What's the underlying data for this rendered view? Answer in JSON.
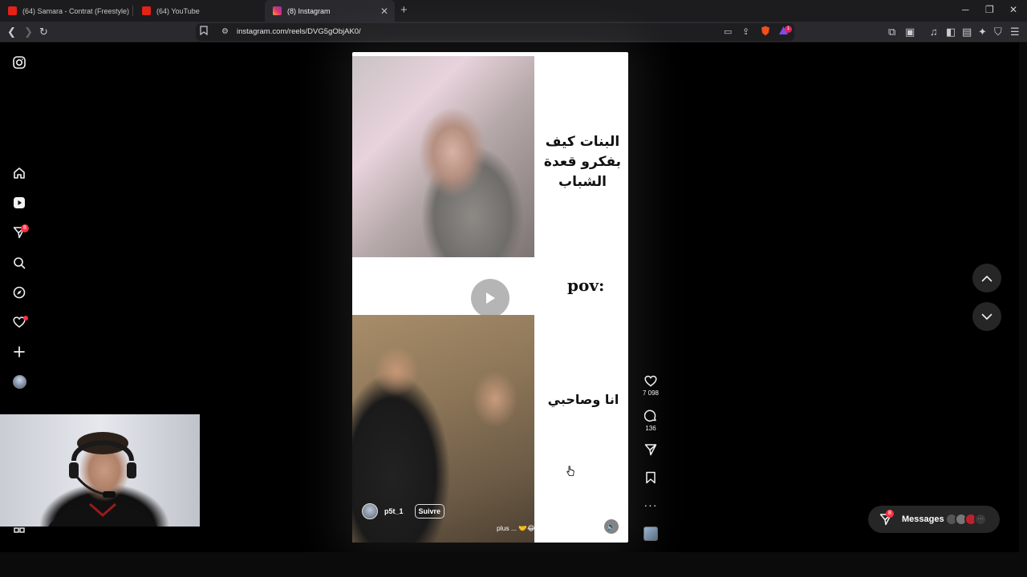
{
  "browser": {
    "tabs": [
      {
        "title": "(64) Samara - Contrat (Freestyle) - Yo",
        "favicon": "youtube-icon",
        "active": false
      },
      {
        "title": "(64) YouTube",
        "favicon": "youtube-icon",
        "active": false
      },
      {
        "title": "(8) Instagram",
        "favicon": "instagram-icon",
        "active": true
      }
    ],
    "url": "instagram.com/reels/DVG5gObjAK0/",
    "extension_badge": "1"
  },
  "instagram": {
    "sidebar": {
      "items": [
        "home-icon",
        "reels-icon",
        "direct-icon",
        "search-icon",
        "explore-icon",
        "notifications-icon",
        "create-icon",
        "profile-avatar"
      ],
      "direct_badge": "8"
    },
    "reel": {
      "overlay_text_top": "البنات كيف بفكرو قعدة الشباب",
      "overlay_text_middle": "pov:",
      "overlay_text_bottom": "انا وصاحبي",
      "author": "p5t_1",
      "follow_label": "Suivre",
      "caption": "كيفك هههههه؟ 😂🤝 ... plus",
      "likes": "7 098",
      "comments": "136"
    },
    "messages": {
      "label": "Messages",
      "badge": "8"
    }
  },
  "colors": {
    "accent_red": "#ff3040",
    "background": "#000000"
  }
}
